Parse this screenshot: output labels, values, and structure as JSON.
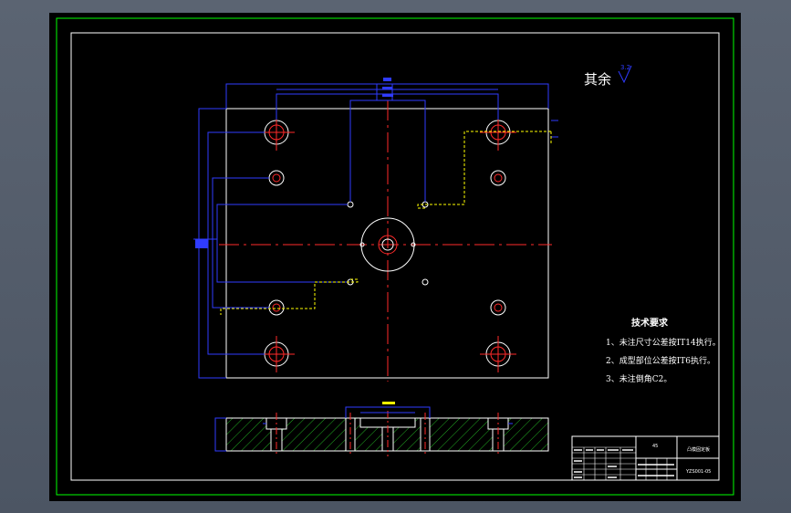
{
  "surface_finish": {
    "label": "其余",
    "value": "3.2"
  },
  "technical_requirements": {
    "title": "技术要求",
    "items": [
      "1、未注尺寸公差按IT14执行。",
      "2、成型部位公差按IT6执行。",
      "3、未注倒角C2。"
    ]
  },
  "title_block": {
    "mark": "45",
    "part_name": "凸模固定板",
    "drawing_no": "YZS001-05"
  },
  "colors": {
    "background": "#000000",
    "border": "#ffffff",
    "outer_border": "#00ff00",
    "outline": "#ffffff",
    "dimension": "#2f3bff",
    "centerline": "#ff2a2a",
    "hidden": "#ffff00",
    "hatch": "#22aa22",
    "app_bg": "#555e6b"
  }
}
